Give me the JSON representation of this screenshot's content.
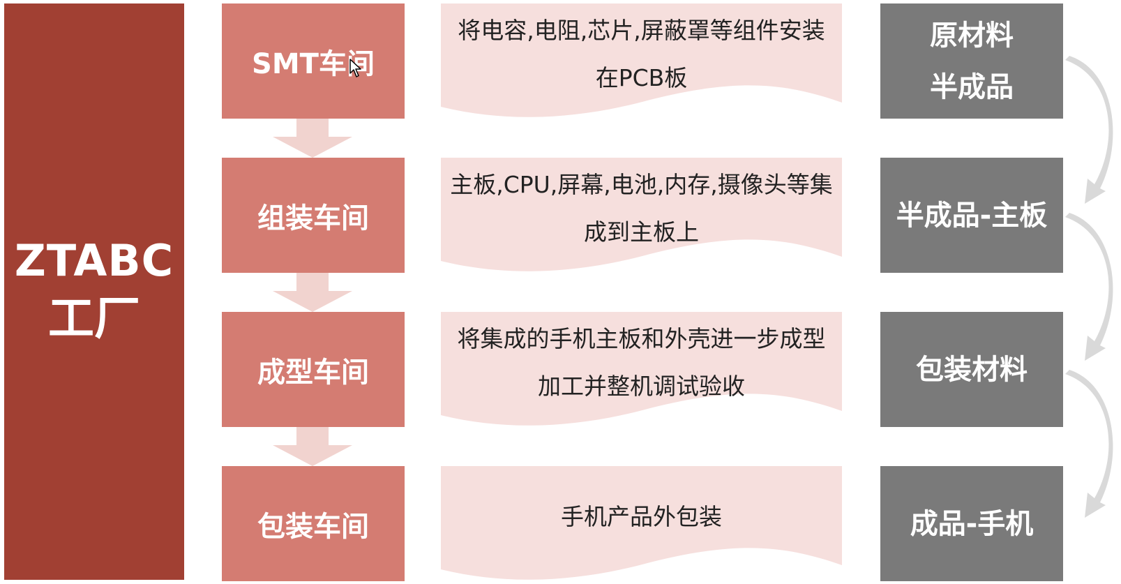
{
  "factory": {
    "name": "ZTABC",
    "sub": "工厂"
  },
  "workshops": [
    {
      "label": "SMT车间"
    },
    {
      "label": "组装车间"
    },
    {
      "label": "成型车间"
    },
    {
      "label": "包装车间"
    }
  ],
  "descriptions": [
    {
      "text": "将电容,电阻,芯片,屏蔽罩等组件安装在PCB板"
    },
    {
      "text": "主板,CPU,屏幕,电池,内存,摄像头等集成到主板上"
    },
    {
      "text": "将集成的手机主板和外壳进一步成型加工并整机调试验收"
    },
    {
      "text": "手机产品外包装"
    }
  ],
  "materials": [
    {
      "text": "原材料\n半成品"
    },
    {
      "text": "半成品-主板"
    },
    {
      "text": "包装材料"
    },
    {
      "text": "成品-手机"
    }
  ],
  "colors": {
    "factory": "#a14033",
    "workshop": "#d47c72",
    "description": "#f6dfdd",
    "material": "#7a7a7a",
    "arrow": "#f1d3cf",
    "curve": "#d9d9d9"
  }
}
